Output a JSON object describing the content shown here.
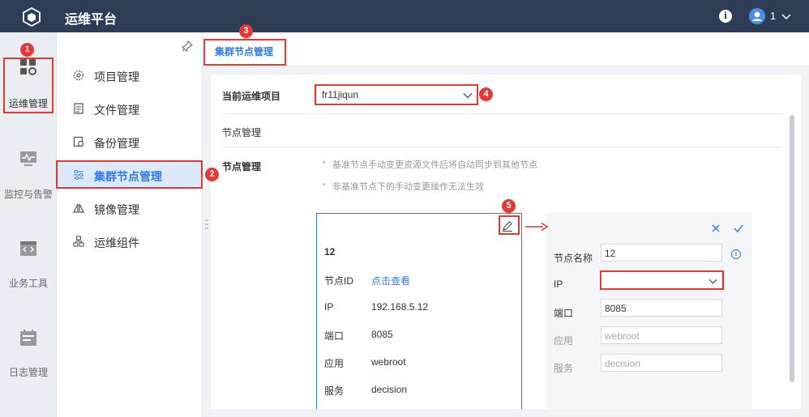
{
  "app": {
    "title": "运维平台",
    "user": "1"
  },
  "rail": [
    {
      "label": "运维管理",
      "icon": "dashboard-icon",
      "active": true
    },
    {
      "label": "监控与告警",
      "icon": "monitor-icon"
    },
    {
      "label": "业务工具",
      "icon": "code-icon"
    },
    {
      "label": "日志管理",
      "icon": "calendar-icon"
    }
  ],
  "submenu": [
    {
      "label": "项目管理",
      "icon": "gear-icon"
    },
    {
      "label": "文件管理",
      "icon": "file-icon"
    },
    {
      "label": "备份管理",
      "icon": "backup-icon"
    },
    {
      "label": "集群节点管理",
      "icon": "sliders-icon",
      "active": true
    },
    {
      "label": "镜像管理",
      "icon": "mirror-icon"
    },
    {
      "label": "运维组件",
      "icon": "components-icon"
    }
  ],
  "tabs": [
    {
      "label": "集群节点管理"
    }
  ],
  "main": {
    "project_label": "当前运维项目",
    "project_value": "fr11jiqun",
    "section_title": "节点管理",
    "node_mgmt_label": "节点管理",
    "tips": [
      "基准节点手动变更资源文件后将自动同步到其他节点",
      "非基准节点下的手动变更操作无法生效"
    ]
  },
  "card": {
    "title": "12",
    "rows": [
      {
        "key": "节点ID",
        "value": "点击查看",
        "link": true
      },
      {
        "key": "IP",
        "value": "192.168.5.12"
      },
      {
        "key": "端口",
        "value": "8085"
      },
      {
        "key": "应用",
        "value": "webroot"
      },
      {
        "key": "服务",
        "value": "decision"
      }
    ]
  },
  "edit": {
    "fields": [
      {
        "label": "节点名称",
        "value": "12"
      },
      {
        "label": "IP",
        "value": ""
      },
      {
        "label": "端口",
        "value": "8085"
      },
      {
        "label": "应用",
        "value": "webroot"
      },
      {
        "label": "服务",
        "value": "decision"
      }
    ]
  },
  "badges": [
    "1",
    "2",
    "3",
    "4",
    "5"
  ],
  "colors": {
    "topbar": "#2e3c55",
    "accent": "#2f7de1",
    "annotation": "#e53935",
    "active_bg": "#dde9fb"
  }
}
